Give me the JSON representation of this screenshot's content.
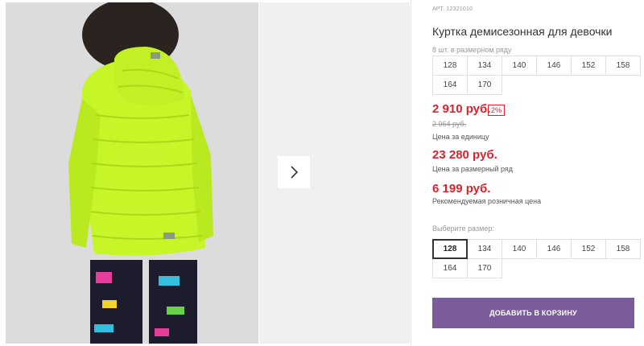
{
  "product": {
    "article": "АРТ. 12321010",
    "title": "Куртка демисезонная для девочки",
    "pack_note": "8 шт. в размерном ряду",
    "pack_sizes": [
      "128",
      "134",
      "140",
      "146",
      "152",
      "158",
      "164",
      "170"
    ],
    "price": "2 910 руб.",
    "discount": "2%",
    "old_price": "2 964 руб.",
    "price_label": "Цена за единицу",
    "row_price": "23 280 руб.",
    "row_price_label": "Цена за размерный ряд",
    "rrp_price": "6 199 руб.",
    "rrp_label": "Рекомендуемая розничная цена",
    "choose_label": "Выберите размер:",
    "select_sizes": [
      "128",
      "134",
      "140",
      "146",
      "152",
      "158",
      "164",
      "170"
    ],
    "selected_size": "128",
    "cart_button": "ДОБАВИТЬ В КОРЗИНУ"
  },
  "gallery": {
    "next_icon": "chevron-right-icon"
  },
  "colors": {
    "price": "#e0202d",
    "button": "#7b5c9a",
    "jacket": "#c6f528"
  }
}
